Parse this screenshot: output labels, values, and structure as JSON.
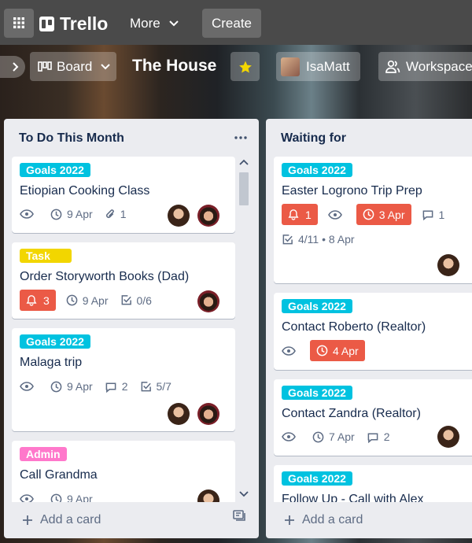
{
  "app": {
    "name": "Trello",
    "more_label": "More",
    "create_label": "Create"
  },
  "board": {
    "view_label": "Board",
    "title": "The House",
    "user_label": "IsaMatt",
    "workspace_label": "Workspace"
  },
  "lists": [
    {
      "title": "To Do This Month",
      "add_card": "Add a card",
      "cards": [
        {
          "label": "Goals 2022",
          "label_color": "#00c2e0",
          "title": "Etiopian Cooking Class",
          "due": "9 Apr",
          "attachments": "1"
        },
        {
          "label": "Task",
          "label_color": "#f2d600",
          "title": "Order Storyworth Books (Dad)",
          "notifications": "3",
          "due": "9 Apr",
          "checklist": "0/6"
        },
        {
          "label": "Goals 2022",
          "label_color": "#00c2e0",
          "title": "Malaga trip",
          "due": "9 Apr",
          "comments": "2",
          "checklist": "5/7"
        },
        {
          "label": "Admin",
          "label_color": "#ff78cb",
          "title": "Call Grandma",
          "due": "9 Apr"
        }
      ]
    },
    {
      "title": "Waiting for",
      "add_card": "Add a card",
      "cards": [
        {
          "label": "Goals 2022",
          "label_color": "#00c2e0",
          "title": "Easter Logrono Trip Prep",
          "notifications": "1",
          "due": "3 Apr",
          "comments": "1",
          "checklist_dates": "4/11 • 8 Apr"
        },
        {
          "label": "Goals 2022",
          "label_color": "#00c2e0",
          "title": "Contact Roberto (Realtor)",
          "due": "4 Apr"
        },
        {
          "label": "Goals 2022",
          "label_color": "#00c2e0",
          "title": "Contact Zandra (Realtor)",
          "due": "7 Apr",
          "comments": "2"
        },
        {
          "label": "Goals 2022",
          "label_color": "#00c2e0",
          "title": "Follow Up - Call with Alex"
        }
      ]
    }
  ],
  "colors": {
    "topbar": "#4a4a4a",
    "list_bg": "#ebecf0",
    "overdue": "#eb5a46",
    "label_goals": "#00c2e0",
    "label_task": "#f2d600",
    "label_admin": "#ff78cb"
  }
}
